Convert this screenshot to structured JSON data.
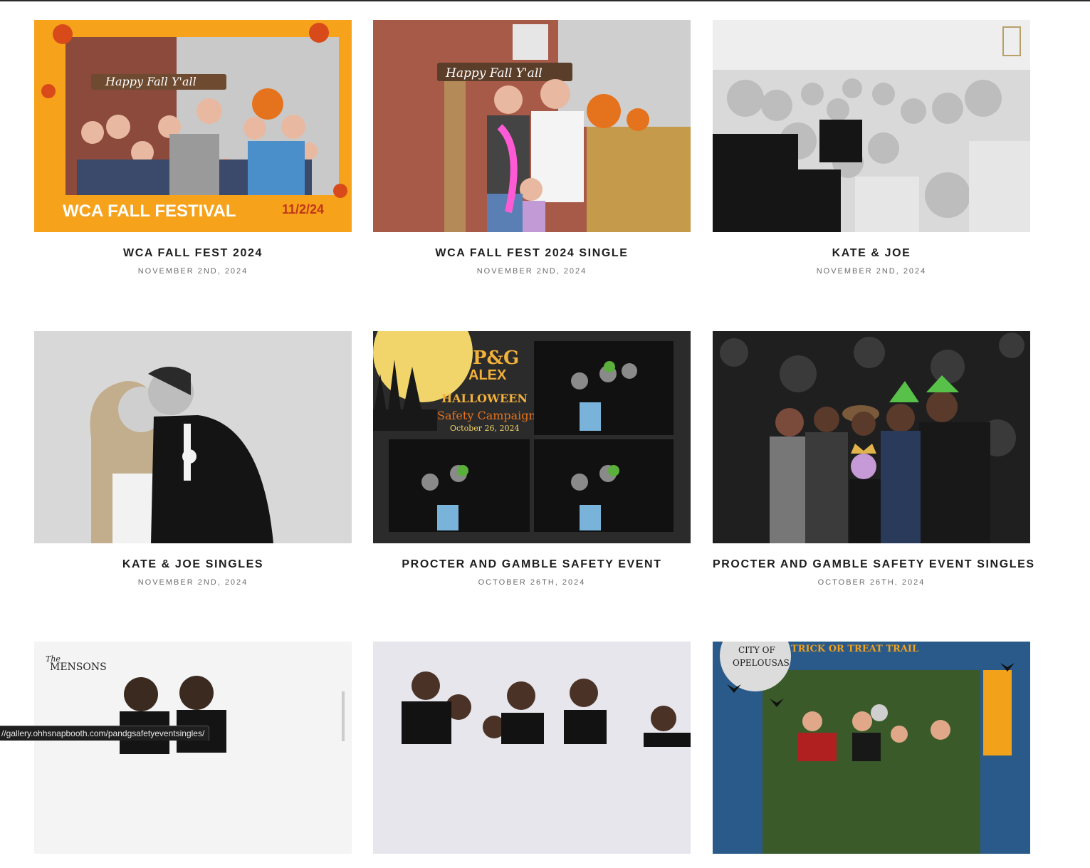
{
  "galleries": [
    {
      "title": "WCA FALL FEST 2024",
      "date": "NOVEMBER 2ND, 2024",
      "photo": "fall-festival-frame-photo",
      "overlay": {
        "main": "WCA FALL FESTIVAL",
        "date": "11/2/24",
        "sign": "Happy Fall Y'all"
      }
    },
    {
      "title": "WCA FALL FEST 2024 SINGLE",
      "date": "NOVEMBER 2ND, 2024",
      "photo": "family-hay-bales-photo",
      "overlay": {
        "sign": "Happy Fall Y'all"
      }
    },
    {
      "title": "KATE & JOE",
      "date": "NOVEMBER 2ND, 2024",
      "photo": "wedding-group-bw-photo"
    },
    {
      "title": "KATE & JOE SINGLES",
      "date": "NOVEMBER 2ND, 2024",
      "photo": "wedding-couple-kiss-bw-photo"
    },
    {
      "title": "PROCTER AND GAMBLE SAFETY EVENT",
      "date": "OCTOBER 26TH, 2024",
      "photo": "halloween-strip-photo",
      "overlay": {
        "brand": "P&G",
        "brand2": "ALEX",
        "line1": "HALLOWEEN",
        "line2": "Safety Campaign",
        "line3": "October 26, 2024"
      }
    },
    {
      "title": "PROCTER AND GAMBLE SAFETY EVENT SINGLES",
      "date": "OCTOBER 26TH, 2024",
      "photo": "costume-group-sequin-photo"
    },
    {
      "title": "",
      "date": "",
      "photo": "mensons-group-photo",
      "overlay": {
        "logo": "MENSONS",
        "logo_prefix": "The"
      }
    },
    {
      "title": "",
      "date": "",
      "photo": "group-white-backdrop-photo"
    },
    {
      "title": "",
      "date": "",
      "photo": "trick-or-treat-trail-photo",
      "overlay": {
        "badge1": "CITY OF",
        "badge2": "OPELOUSAS",
        "banner": "TRICK OR TREAT TRAIL"
      }
    }
  ],
  "status_bar": {
    "url": "//gallery.ohhsnapbooth.com/pandgsafetyeventsingles/"
  }
}
